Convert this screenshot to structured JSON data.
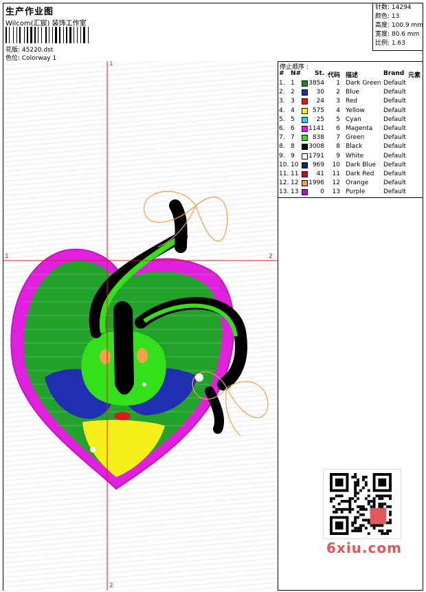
{
  "header": {
    "title": "生产作业图",
    "studio": "Wilcom(汇宸) 装饰工作室",
    "file_label": "花版: 45220.dst",
    "colorway_label": "色位: Colorway 1"
  },
  "stats": [
    "针数: 14294",
    "颜色: 13",
    "高度: 100.9 mm",
    "宽度: 80.6 mm",
    "比例: 1.63"
  ],
  "axis": {
    "top": "1",
    "left": "1",
    "right": "2",
    "bottom": "2"
  },
  "table": {
    "title": "停止顺序 :",
    "headers": [
      "#",
      "N#",
      "St.",
      "代码",
      "描述",
      "Brand",
      "元素"
    ],
    "rows": [
      {
        "idx": "1.",
        "n": "1",
        "st": "3854",
        "code": "1",
        "desc": "Dark Green",
        "brand": "Default",
        "color": "#1a8a1a"
      },
      {
        "idx": "2.",
        "n": "2",
        "st": "30",
        "code": "2",
        "desc": "Blue",
        "brand": "Default",
        "color": "#1f2fb0"
      },
      {
        "idx": "3.",
        "n": "3",
        "st": "24",
        "code": "3",
        "desc": "Red",
        "brand": "Default",
        "color": "#e01a1a"
      },
      {
        "idx": "4.",
        "n": "4",
        "st": "575",
        "code": "4",
        "desc": "Yellow",
        "brand": "Default",
        "color": "#f5ef1a"
      },
      {
        "idx": "5.",
        "n": "5",
        "st": "25",
        "code": "5",
        "desc": "Cyan",
        "brand": "Default",
        "color": "#1ad6e6"
      },
      {
        "idx": "6.",
        "n": "6",
        "st": "1141",
        "code": "6",
        "desc": "Magenta",
        "brand": "Default",
        "color": "#e61ae0"
      },
      {
        "idx": "7.",
        "n": "7",
        "st": "838",
        "code": "7",
        "desc": "Green",
        "brand": "Default",
        "color": "#33e01a"
      },
      {
        "idx": "8.",
        "n": "8",
        "st": "3008",
        "code": "8",
        "desc": "Black",
        "brand": "Default",
        "color": "#000000"
      },
      {
        "idx": "9.",
        "n": "9",
        "st": "1791",
        "code": "9",
        "desc": "White",
        "brand": "Default",
        "color": "#ffffff"
      },
      {
        "idx": "10.",
        "n": "10",
        "st": "969",
        "code": "10",
        "desc": "Dark Blue",
        "brand": "Default",
        "color": "#151f8a"
      },
      {
        "idx": "11.",
        "n": "11",
        "st": "41",
        "code": "11",
        "desc": "Dark Red",
        "brand": "Default",
        "color": "#b81515"
      },
      {
        "idx": "12.",
        "n": "12",
        "st": "1996",
        "code": "12",
        "desc": "Orange",
        "brand": "Default",
        "color": "#f5a04a"
      },
      {
        "idx": "13.",
        "n": "13",
        "st": "0",
        "code": "13",
        "desc": "Purple",
        "brand": "Default",
        "color": "#a21ac9"
      }
    ]
  },
  "watermark": {
    "text": "6xiu.com"
  }
}
